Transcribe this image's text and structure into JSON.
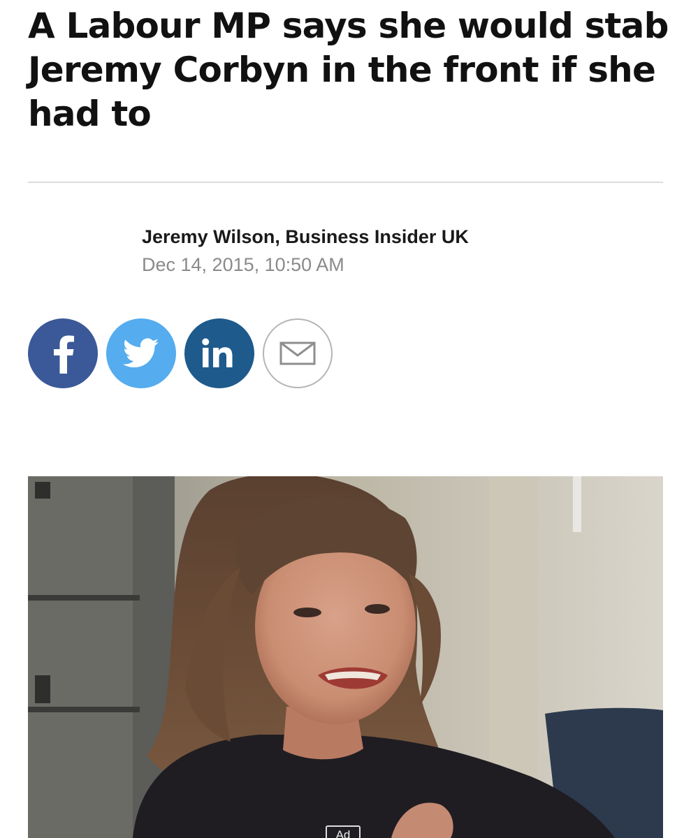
{
  "article": {
    "headline": "A Labour MP says she would stab Jeremy Corbyn in the front if she had to",
    "author": "Jeremy Wilson, Business Insider UK",
    "date": "Dec 14, 2015, 10:50 AM"
  },
  "share": [
    {
      "name": "facebook",
      "icon": "facebook-icon",
      "color": "#3b5998"
    },
    {
      "name": "twitter",
      "icon": "twitter-icon",
      "color": "#55acee"
    },
    {
      "name": "linkedin",
      "icon": "linkedin-icon",
      "color": "#1f5a8c"
    },
    {
      "name": "email",
      "icon": "envelope-icon",
      "color": "#8e8e8e"
    }
  ],
  "video": {
    "ad_label": "Ad"
  }
}
